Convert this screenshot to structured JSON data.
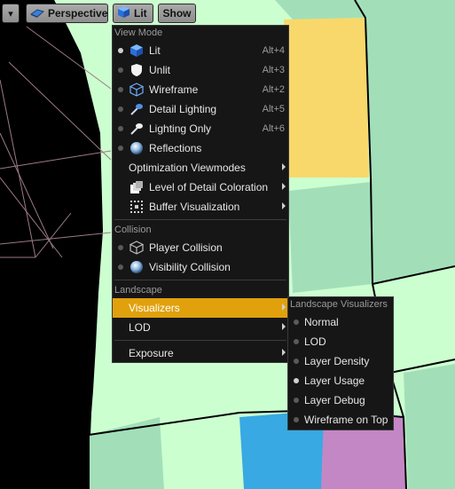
{
  "toolbar": {
    "dropdown_label": "▾",
    "perspective_label": "Perspective",
    "lit_label": "Lit",
    "show_label": "Show"
  },
  "view_menu": {
    "section_view_mode": "View Mode",
    "modes": [
      {
        "label": "Lit",
        "shortcut": "Alt+4",
        "icon": "lit-cube-icon"
      },
      {
        "label": "Unlit",
        "shortcut": "Alt+3",
        "icon": "unlit-shield-icon"
      },
      {
        "label": "Wireframe",
        "shortcut": "Alt+2",
        "icon": "wireframe-cube-icon"
      },
      {
        "label": "Detail Lighting",
        "shortcut": "Alt+5",
        "icon": "detail-lighting-icon"
      },
      {
        "label": "Lighting Only",
        "shortcut": "Alt+6",
        "icon": "lighting-only-icon"
      },
      {
        "label": "Reflections",
        "shortcut": "",
        "icon": "reflections-sphere-icon"
      }
    ],
    "optimization_label": "Optimization Viewmodes",
    "lod_coloration_label": "Level of Detail Coloration",
    "buffer_label": "Buffer Visualization",
    "section_collision": "Collision",
    "player_collision_label": "Player Collision",
    "visibility_collision_label": "Visibility Collision",
    "section_landscape": "Landscape",
    "visualizers_label": "Visualizers",
    "lod_label": "LOD",
    "exposure_label": "Exposure"
  },
  "visualizers_menu": {
    "header": "Landscape Visualizers",
    "items": [
      {
        "label": "Normal",
        "selected": false
      },
      {
        "label": "LOD",
        "selected": false
      },
      {
        "label": "Layer Density",
        "selected": false
      },
      {
        "label": "Layer Usage",
        "selected": true
      },
      {
        "label": "Layer Debug",
        "selected": false
      },
      {
        "label": "Wireframe on Top",
        "selected": false
      }
    ]
  },
  "colors": {
    "highlight": "#e0a10c",
    "terrain_light_green": "#ccffd0",
    "terrain_green": "#a2dfb9",
    "terrain_yellow": "#f8d86a",
    "terrain_blue": "#38a9e3",
    "terrain_pink": "#c487c5"
  }
}
